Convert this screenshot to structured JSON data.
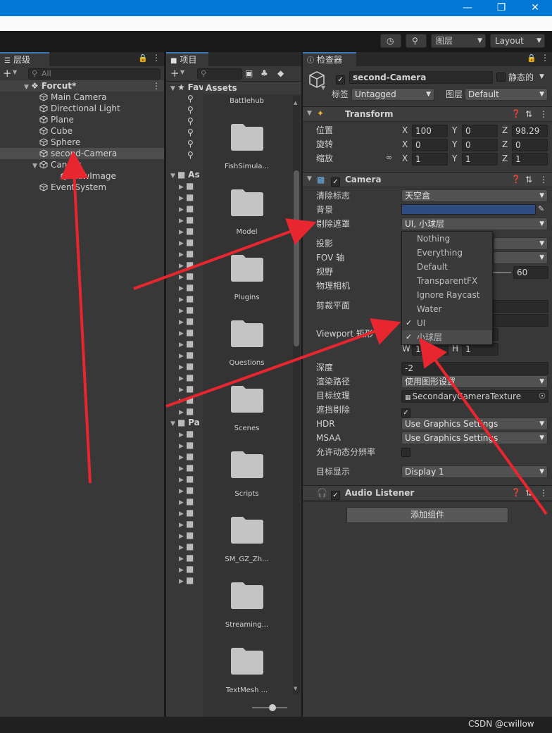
{
  "colors": {
    "accent": "#3a79bb",
    "arrow": "#e8262f",
    "titlebar": "#0078d4"
  },
  "toolbar": {
    "history_icon": "history-icon",
    "search_icon": "search-icon",
    "layers_label": "图层",
    "layout_label": "Layout"
  },
  "hierarchy": {
    "tab_label": "层级",
    "search_placeholder": "All",
    "scene_name": "Forcut*",
    "items": [
      {
        "label": "Main Camera"
      },
      {
        "label": "Directional Light"
      },
      {
        "label": "Plane"
      },
      {
        "label": "Cube"
      },
      {
        "label": "Sphere"
      },
      {
        "label": "second-Camera"
      },
      {
        "label": "Canvas"
      },
      {
        "label": "RawImage"
      },
      {
        "label": "EventSystem"
      }
    ]
  },
  "project": {
    "tab_label": "项目",
    "favorites_label": "Fav",
    "assets_root_label": "As",
    "packages_label": "Pa",
    "assets_header": "Assets",
    "folders": [
      {
        "label": "Battlehub"
      },
      {
        "label": "FishSimula..."
      },
      {
        "label": "Model"
      },
      {
        "label": "Plugins"
      },
      {
        "label": "Questions"
      },
      {
        "label": "Scenes"
      },
      {
        "label": "Scripts"
      },
      {
        "label": "SM_GZ_Zh..."
      },
      {
        "label": "Streaming..."
      },
      {
        "label": "TextMesh ..."
      }
    ]
  },
  "inspector": {
    "tab_label": "检查器",
    "object_name": "second-Camera",
    "static_label": "静态的",
    "tag_label": "标签",
    "tag_value": "Untagged",
    "layer_label": "图层",
    "layer_value": "Default",
    "transform": {
      "title": "Transform",
      "position_label": "位置",
      "pos_x": "100",
      "pos_y": "0",
      "pos_z": "98.29",
      "rotation_label": "旋转",
      "rot_x": "0",
      "rot_y": "0",
      "rot_z": "0",
      "scale_label": "缩放",
      "scale_x": "1",
      "scale_y": "1",
      "scale_z": "1"
    },
    "axes": {
      "x": "X",
      "y": "Y",
      "z": "Z",
      "w": "W",
      "h": "H"
    },
    "camera": {
      "title": "Camera",
      "clear_flags_label": "清除标志",
      "clear_flags_value": "天空盒",
      "background_label": "背景",
      "background_color": "#2f4c80",
      "culling_mask_label": "剔除遮罩",
      "culling_mask_value": "UI, 小球层",
      "projection_label": "投影",
      "fov_axis_label": "FOV 轴",
      "fov_label": "视野",
      "fov_value": "60",
      "physical_label": "物理相机",
      "clipping_label": "剪裁平面",
      "viewport_label": "Viewport 矩形",
      "viewport_w": "1",
      "viewport_h": "1",
      "depth_label": "深度",
      "depth_value": "-2",
      "render_path_label": "渲染路径",
      "render_path_value": "使用图形设置",
      "target_texture_label": "目标纹理",
      "target_texture_value": "SecondaryCameraTexture",
      "occlusion_label": "遮挡剔除",
      "hdr_label": "HDR",
      "hdr_value": "Use Graphics Settings",
      "msaa_label": "MSAA",
      "msaa_value": "Use Graphics Settings",
      "dynamic_res_label": "允许动态分辨率",
      "target_display_label": "目标显示",
      "target_display_value": "Display 1"
    },
    "culling_options": [
      {
        "label": "Nothing",
        "checked": false
      },
      {
        "label": "Everything",
        "checked": false
      },
      {
        "label": "Default",
        "checked": false
      },
      {
        "label": "TransparentFX",
        "checked": false
      },
      {
        "label": "Ignore Raycast",
        "checked": false
      },
      {
        "label": "Water",
        "checked": false
      },
      {
        "label": "UI",
        "checked": true
      },
      {
        "label": "小球层",
        "checked": true
      }
    ],
    "audio_listener": {
      "title": "Audio Listener"
    },
    "add_component_label": "添加组件"
  },
  "watermark": "CSDN @cwillow"
}
